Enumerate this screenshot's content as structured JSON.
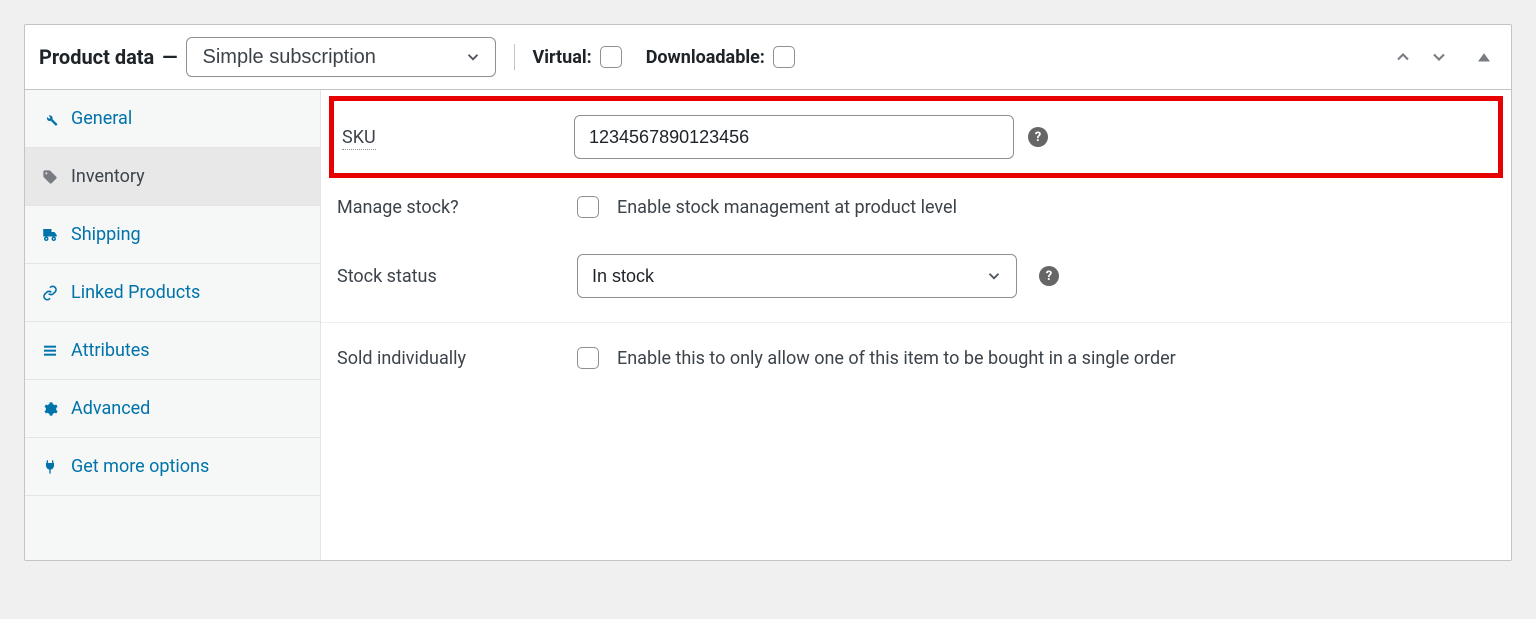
{
  "header": {
    "title": "Product data",
    "dash": "—",
    "product_type": "Simple subscription",
    "virtual_label": "Virtual:",
    "downloadable_label": "Downloadable:"
  },
  "sidebar": {
    "items": [
      {
        "label": "General"
      },
      {
        "label": "Inventory"
      },
      {
        "label": "Shipping"
      },
      {
        "label": "Linked Products"
      },
      {
        "label": "Attributes"
      },
      {
        "label": "Advanced"
      },
      {
        "label": "Get more options"
      }
    ]
  },
  "form": {
    "sku_label": "SKU",
    "sku_value": "1234567890123456",
    "manage_stock_label": "Manage stock?",
    "manage_stock_desc": "Enable stock management at product level",
    "stock_status_label": "Stock status",
    "stock_status_value": "In stock",
    "sold_individually_label": "Sold individually",
    "sold_individually_desc": "Enable this to only allow one of this item to be bought in a single order"
  }
}
